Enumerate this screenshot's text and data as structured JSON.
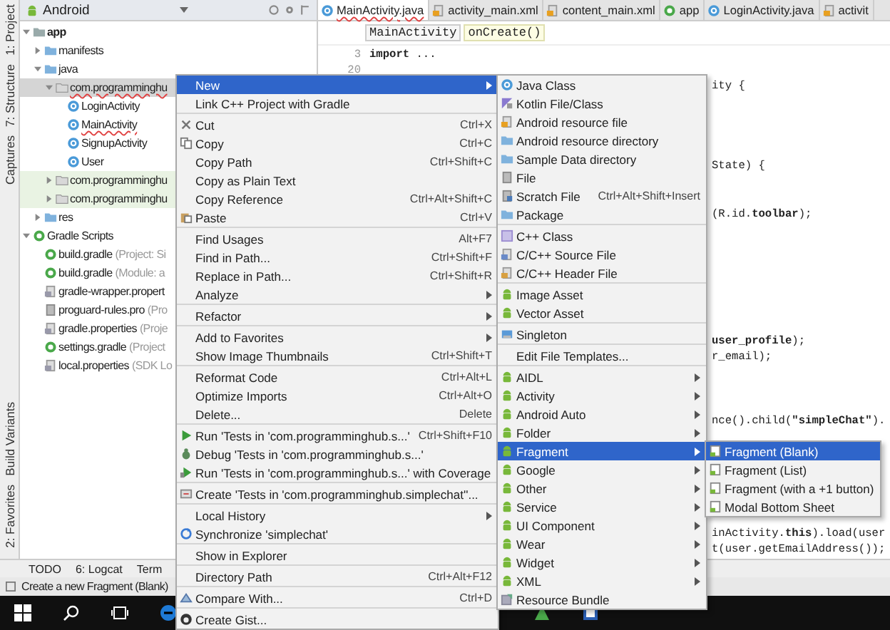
{
  "side_strip": {
    "top": [
      "1: Project",
      "7: Structure",
      "Captures"
    ],
    "bottom": [
      "Build Variants",
      "2: Favorites"
    ]
  },
  "project_panel": {
    "view": "Android",
    "tree": [
      {
        "label": "app",
        "kind": "module",
        "expanded": true,
        "selected": false,
        "error": false,
        "test": false,
        "children": [
          {
            "label": "manifests",
            "kind": "folder",
            "expanded": false,
            "selected": false,
            "error": false,
            "test": false
          },
          {
            "label": "java",
            "kind": "folder",
            "expanded": true,
            "selected": false,
            "error": false,
            "test": false,
            "children": [
              {
                "label": "com.programminghu",
                "kind": "package",
                "expanded": true,
                "selected": true,
                "error": true,
                "test": false,
                "children": [
                  {
                    "label": "LoginActivity",
                    "kind": "class",
                    "selected": false,
                    "error": false,
                    "test": false
                  },
                  {
                    "label": "MainActivity",
                    "kind": "class",
                    "selected": false,
                    "error": true,
                    "test": false
                  },
                  {
                    "label": "SignupActivity",
                    "kind": "class",
                    "selected": false,
                    "error": false,
                    "test": false
                  },
                  {
                    "label": "User",
                    "kind": "class",
                    "selected": false,
                    "error": false,
                    "test": false
                  }
                ]
              },
              {
                "label": "com.programminghu",
                "kind": "package",
                "expanded": false,
                "selected": false,
                "error": false,
                "test": true
              },
              {
                "label": "com.programminghu",
                "kind": "package",
                "expanded": false,
                "selected": false,
                "error": false,
                "test": true
              }
            ]
          },
          {
            "label": "res",
            "kind": "folder",
            "expanded": false,
            "selected": false,
            "error": false,
            "test": false
          }
        ]
      },
      {
        "label": "Gradle Scripts",
        "kind": "gradle",
        "expanded": true,
        "selected": false,
        "error": false,
        "test": false,
        "children": [
          {
            "label": "build.gradle",
            "detail": "(Project: Si",
            "kind": "gradle",
            "selected": false,
            "error": false,
            "test": false
          },
          {
            "label": "build.gradle",
            "detail": "(Module: a",
            "kind": "gradle",
            "selected": false,
            "error": false,
            "test": false
          },
          {
            "label": "gradle-wrapper.propert",
            "kind": "props",
            "selected": false,
            "error": false,
            "test": false
          },
          {
            "label": "proguard-rules.pro",
            "detail": "(Pro",
            "kind": "file",
            "selected": false,
            "error": false,
            "test": false
          },
          {
            "label": "gradle.properties",
            "detail": "(Proje",
            "kind": "props",
            "selected": false,
            "error": false,
            "test": false
          },
          {
            "label": "settings.gradle",
            "detail": "(Project",
            "kind": "gradle",
            "selected": false,
            "error": false,
            "test": false
          },
          {
            "label": "local.properties",
            "detail": "(SDK Lo",
            "kind": "props",
            "selected": false,
            "error": false,
            "test": false
          }
        ]
      }
    ]
  },
  "editor": {
    "tabs": [
      {
        "label": "MainActivity.java",
        "kind": "class",
        "selected": true
      },
      {
        "label": "activity_main.xml",
        "kind": "xml",
        "selected": false
      },
      {
        "label": "content_main.xml",
        "kind": "xml",
        "selected": false
      },
      {
        "label": "app",
        "kind": "gradle",
        "selected": false
      },
      {
        "label": "LoginActivity.java",
        "kind": "class",
        "selected": false
      },
      {
        "label": "activit",
        "kind": "xml",
        "selected": false
      }
    ],
    "breadcrumbs": [
      "MainActivity",
      "onCreate()"
    ],
    "code_lines": [
      {
        "number": "3",
        "text": "**import** ...",
        "kind": "start"
      },
      {
        "number": "20"
      },
      {
        "text": "ity {",
        "kind": "tail"
      },
      {
        "text": "State) {",
        "kind": "tail"
      },
      {
        "text": "(R.id.**toolbar**);",
        "kind": "tail"
      },
      {
        "text": "**user_profile**);",
        "kind": "tail"
      },
      {
        "text": "r_email);",
        "kind": "tail"
      },
      {
        "text": "nce().child(**\"simpleChat\"**).",
        "kind": "tail"
      },
      {
        "text": "inActivity.**this**).load(user",
        "kind": "tail"
      },
      {
        "text": "t(user.getEmailAddress());",
        "kind": "tail"
      }
    ]
  },
  "tool_windows": [
    "TODO",
    "6: Logcat",
    "Term"
  ],
  "status_bar": "Create a new Fragment (Blank)",
  "context_menu": {
    "groups": [
      [
        {
          "label": "New",
          "submenu": true,
          "selected": true
        },
        {
          "label": "Link C++ Project with Gradle",
          "selected": false
        }
      ],
      [
        {
          "label": "Cut",
          "shortcut": "Ctrl+X",
          "kind": "cut",
          "selected": false
        },
        {
          "label": "Copy",
          "shortcut": "Ctrl+C",
          "kind": "copy",
          "selected": false
        },
        {
          "label": "Copy Path",
          "shortcut": "Ctrl+Shift+C",
          "selected": false
        },
        {
          "label": "Copy as Plain Text",
          "selected": false
        },
        {
          "label": "Copy Reference",
          "shortcut": "Ctrl+Alt+Shift+C",
          "selected": false
        },
        {
          "label": "Paste",
          "shortcut": "Ctrl+V",
          "kind": "paste",
          "selected": false
        }
      ],
      [
        {
          "label": "Find Usages",
          "shortcut": "Alt+F7",
          "selected": false
        },
        {
          "label": "Find in Path...",
          "shortcut": "Ctrl+Shift+F",
          "selected": false
        },
        {
          "label": "Replace in Path...",
          "shortcut": "Ctrl+Shift+R",
          "selected": false
        },
        {
          "label": "Analyze",
          "submenu": true,
          "selected": false
        }
      ],
      [
        {
          "label": "Refactor",
          "submenu": true,
          "selected": false
        }
      ],
      [
        {
          "label": "Add to Favorites",
          "submenu": true,
          "selected": false
        },
        {
          "label": "Show Image Thumbnails",
          "shortcut": "Ctrl+Shift+T",
          "selected": false
        }
      ],
      [
        {
          "label": "Reformat Code",
          "shortcut": "Ctrl+Alt+L",
          "selected": false
        },
        {
          "label": "Optimize Imports",
          "shortcut": "Ctrl+Alt+O",
          "selected": false
        },
        {
          "label": "Delete...",
          "shortcut": "Delete",
          "selected": false
        }
      ],
      [
        {
          "label": "Run 'Tests in 'com.programminghub.s...'",
          "shortcut": "Ctrl+Shift+F10",
          "kind": "run",
          "selected": false
        },
        {
          "label": "Debug 'Tests in 'com.programminghub.s...'",
          "kind": "debug",
          "selected": false
        },
        {
          "label": "Run 'Tests in 'com.programminghub.s...' with Coverage",
          "kind": "coverage",
          "selected": false
        }
      ],
      [
        {
          "label": "Create 'Tests in 'com.programminghub.simplechat''...",
          "kind": "tests",
          "selected": false
        }
      ],
      [
        {
          "label": "Local History",
          "submenu": true,
          "selected": false
        },
        {
          "label": "Synchronize 'simplechat'",
          "kind": "sync",
          "selected": false
        }
      ],
      [
        {
          "label": "Show in Explorer",
          "selected": false
        }
      ],
      [
        {
          "label": "Directory Path",
          "shortcut": "Ctrl+Alt+F12",
          "selected": false
        }
      ],
      [
        {
          "label": "Compare With...",
          "shortcut": "Ctrl+D",
          "kind": "compare",
          "selected": false
        }
      ],
      [
        {
          "label": "Create Gist...",
          "kind": "github",
          "selected": false
        }
      ]
    ]
  },
  "new_submenu": {
    "groups": [
      [
        {
          "label": "Java Class",
          "kind": "class",
          "selected": false
        },
        {
          "label": "Kotlin File/Class",
          "kind": "kotlin",
          "selected": false
        },
        {
          "label": "Android resource file",
          "kind": "xml",
          "selected": false
        },
        {
          "label": "Android resource directory",
          "kind": "folder",
          "selected": false
        },
        {
          "label": "Sample Data directory",
          "kind": "folder",
          "selected": false
        },
        {
          "label": "File",
          "kind": "file",
          "selected": false
        },
        {
          "label": "Scratch File",
          "shortcut": "Ctrl+Alt+Shift+Insert",
          "kind": "scratch",
          "selected": false
        },
        {
          "label": "Package",
          "kind": "folder",
          "selected": false
        }
      ],
      [
        {
          "label": "C++ Class",
          "kind": "cpp",
          "selected": false
        },
        {
          "label": "C/C++ Source File",
          "kind": "cfile",
          "selected": false
        },
        {
          "label": "C/C++ Header File",
          "kind": "hfile",
          "selected": false
        }
      ],
      [
        {
          "label": "Image Asset",
          "kind": "android",
          "selected": false
        },
        {
          "label": "Vector Asset",
          "kind": "android",
          "selected": false
        }
      ],
      [
        {
          "label": "Singleton",
          "kind": "singleton",
          "selected": false
        }
      ],
      [
        {
          "label": "Edit File Templates...",
          "selected": false
        }
      ],
      [
        {
          "label": "AIDL",
          "kind": "android",
          "submenu": true,
          "selected": false
        },
        {
          "label": "Activity",
          "kind": "android",
          "submenu": true,
          "selected": false
        },
        {
          "label": "Android Auto",
          "kind": "android",
          "submenu": true,
          "selected": false
        },
        {
          "label": "Folder",
          "kind": "android",
          "submenu": true,
          "selected": false
        },
        {
          "label": "Fragment",
          "kind": "android",
          "submenu": true,
          "selected": true
        },
        {
          "label": "Google",
          "kind": "android",
          "submenu": true,
          "selected": false
        },
        {
          "label": "Other",
          "kind": "android",
          "submenu": true,
          "selected": false
        },
        {
          "label": "Service",
          "kind": "android",
          "submenu": true,
          "selected": false
        },
        {
          "label": "UI Component",
          "kind": "android",
          "submenu": true,
          "selected": false
        },
        {
          "label": "Wear",
          "kind": "android",
          "submenu": true,
          "selected": false
        },
        {
          "label": "Widget",
          "kind": "android",
          "submenu": true,
          "selected": false
        },
        {
          "label": "XML",
          "kind": "android",
          "submenu": true,
          "selected": false
        },
        {
          "label": "Resource Bundle",
          "kind": "bundle",
          "selected": false
        }
      ]
    ]
  },
  "fragment_submenu": {
    "groups": [
      [
        {
          "label": "Fragment (Blank)",
          "kind": "template",
          "selected": true
        },
        {
          "label": "Fragment (List)",
          "kind": "template",
          "selected": false
        },
        {
          "label": "Fragment (with a +1 button)",
          "kind": "template",
          "selected": false
        },
        {
          "label": "Modal Bottom Sheet",
          "kind": "template",
          "selected": false
        }
      ]
    ]
  }
}
